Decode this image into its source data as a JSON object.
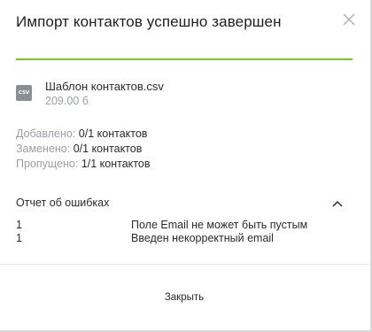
{
  "dialog": {
    "title": "Импорт контактов успешно завершен",
    "close_icon": "close-icon",
    "progress_color": "#7cc52e"
  },
  "file": {
    "icon_label": "CSV",
    "name": "Шаблон контактов.csv",
    "size": "209.00 б"
  },
  "stats": [
    {
      "label": "Добавлено:",
      "value": "0/1 контактов"
    },
    {
      "label": "Заменено:",
      "value": "0/1 контактов"
    },
    {
      "label": "Пропущено:",
      "value": "1/1 контактов"
    }
  ],
  "errors": {
    "title": "Отчет об ошибках",
    "toggle_icon": "chevron-up-icon",
    "rows": [
      {
        "count": "1",
        "message": "Поле Email не может быть пустым"
      },
      {
        "count": "1",
        "message": "Введен некорректный email"
      }
    ]
  },
  "footer": {
    "close_label": "Закрыть"
  }
}
